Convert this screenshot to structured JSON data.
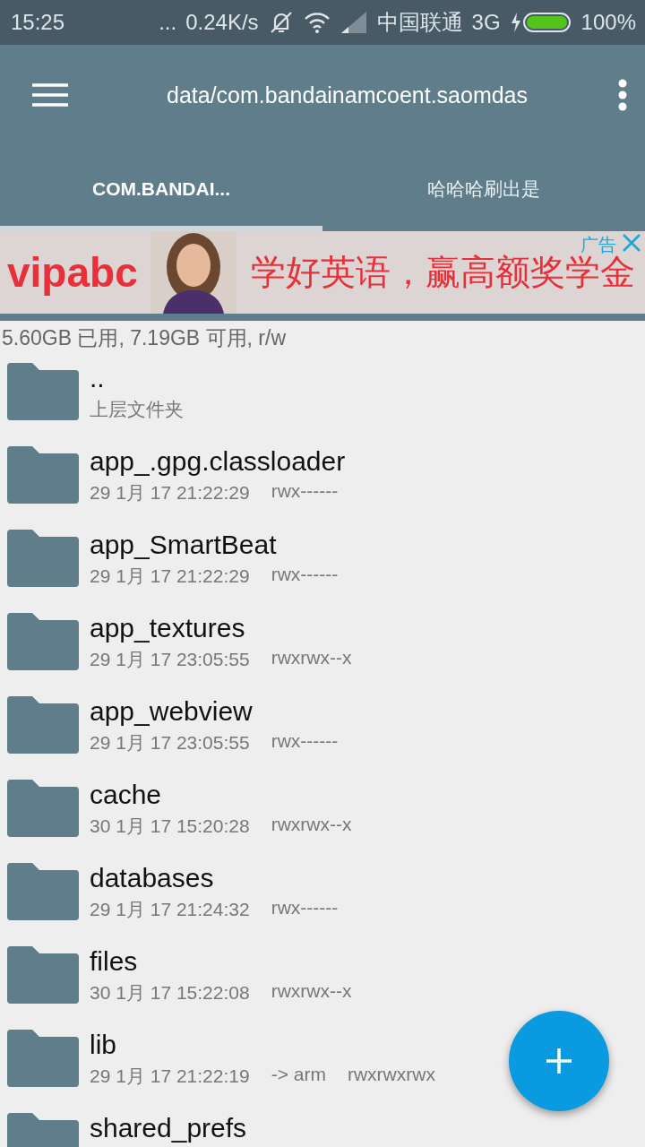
{
  "status_bar": {
    "time": "15:25",
    "dots": "...",
    "speed": "0.24K/s",
    "carrier": "中国联通",
    "network": "3G",
    "battery": "100%"
  },
  "toolbar": {
    "path": "data/com.bandainamcoent.saomdas"
  },
  "tabs": [
    {
      "label": "COM.BANDAI...",
      "selected": true
    },
    {
      "label": "哈哈哈刷出是",
      "selected": false
    }
  ],
  "ad": {
    "tag": "广告",
    "brand": "vipabc",
    "slogan": "学好英语，赢高额奖学金"
  },
  "storage": "5.60GB 已用, 7.19GB 可用, r/w",
  "files": [
    {
      "kind": "parent",
      "name": "..",
      "detail": "上层文件夹"
    },
    {
      "kind": "folder",
      "name": "app_.gpg.classloader",
      "date": "29 1月 17 21:22:29",
      "perms": "rwx------"
    },
    {
      "kind": "folder",
      "name": "app_SmartBeat",
      "date": "29 1月 17 21:22:29",
      "perms": "rwx------"
    },
    {
      "kind": "folder",
      "name": "app_textures",
      "date": "29 1月 17 23:05:55",
      "perms": "rwxrwx--x"
    },
    {
      "kind": "folder",
      "name": "app_webview",
      "date": "29 1月 17 23:05:55",
      "perms": "rwx------"
    },
    {
      "kind": "folder",
      "name": "cache",
      "date": "30 1月 17 15:20:28",
      "perms": "rwxrwx--x"
    },
    {
      "kind": "folder",
      "name": "databases",
      "date": "29 1月 17 21:24:32",
      "perms": "rwx------"
    },
    {
      "kind": "folder",
      "name": "files",
      "date": "30 1月 17 15:22:08",
      "perms": "rwxrwx--x"
    },
    {
      "kind": "folder",
      "name": "lib",
      "date": "29 1月 17 21:22:19",
      "link": "-> arm",
      "perms": "rwxrwxrwx"
    },
    {
      "kind": "folder",
      "name": "shared_prefs"
    }
  ]
}
